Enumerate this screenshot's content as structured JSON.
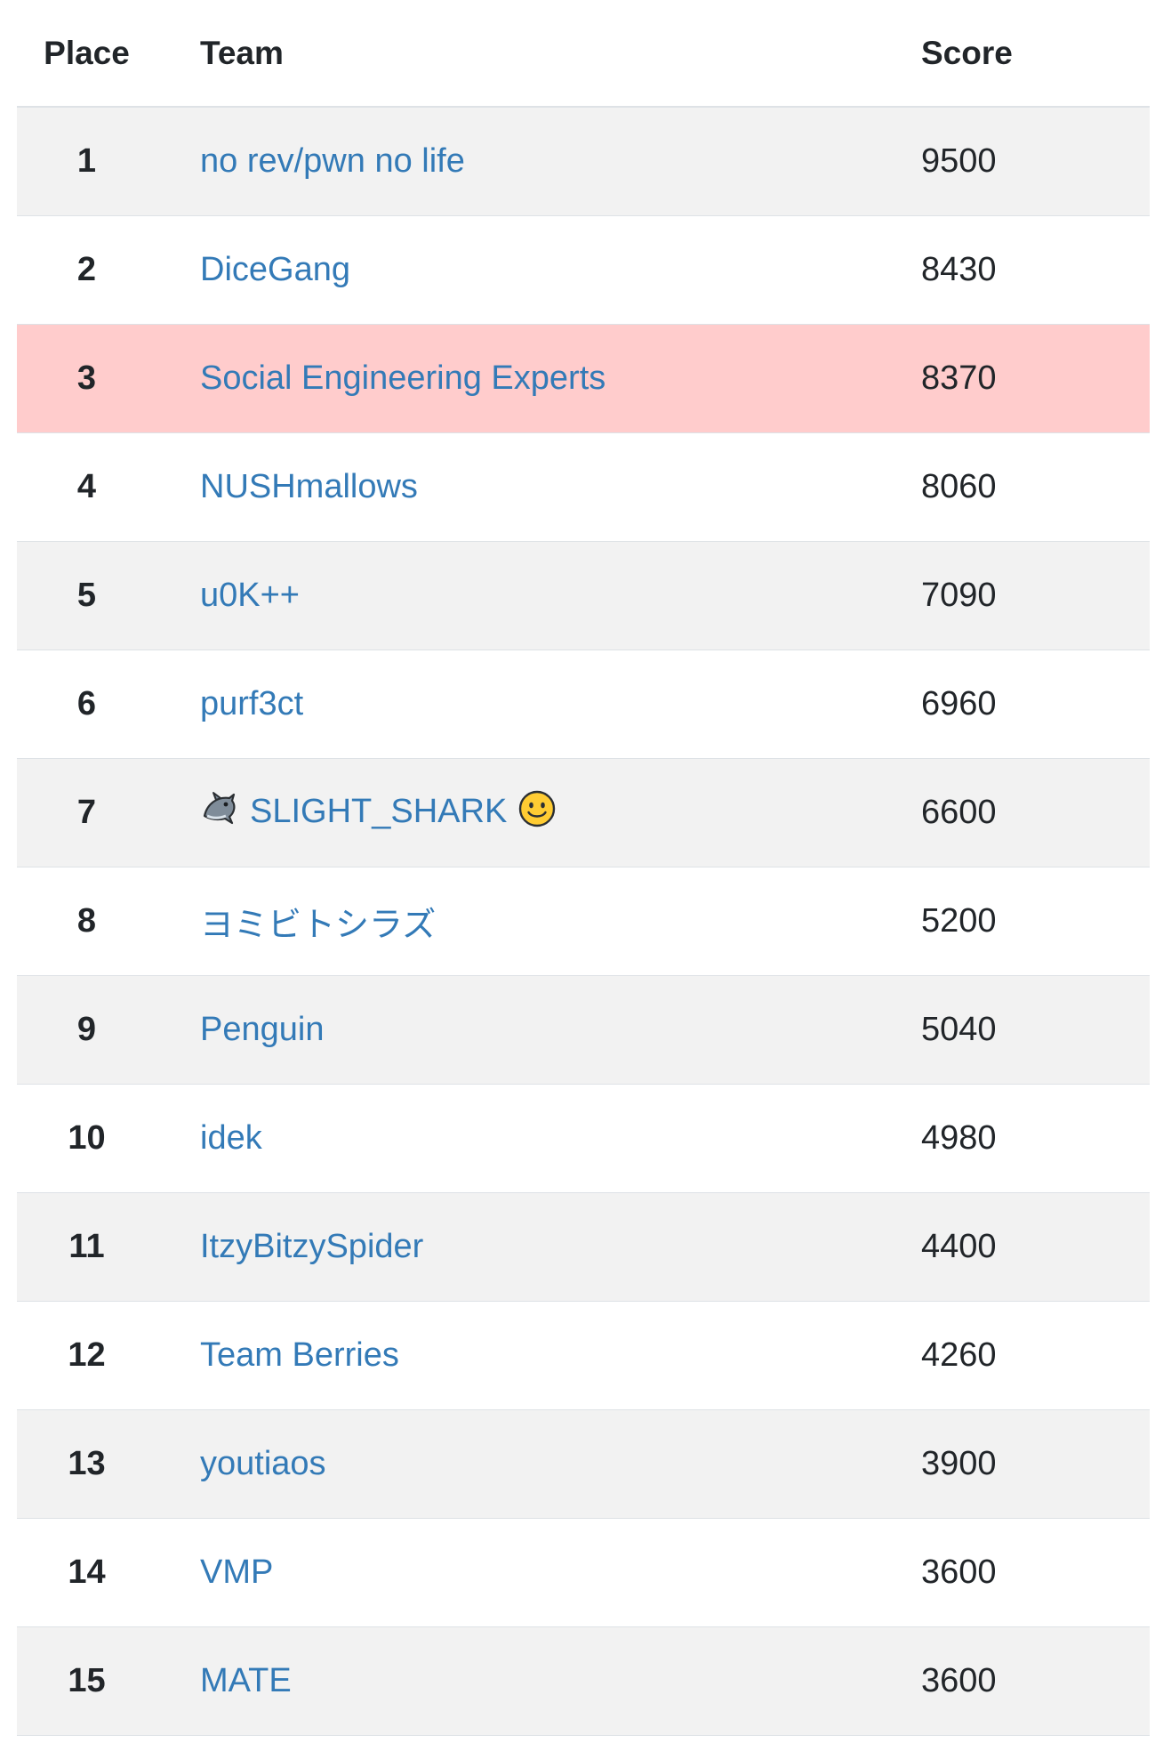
{
  "table": {
    "headers": {
      "place": "Place",
      "team": "Team",
      "score": "Score"
    },
    "highlight_color": "#ffcccc",
    "link_color": "#337ab7",
    "rows": [
      {
        "place": "1",
        "team": "no rev/pwn no life",
        "score": "9500"
      },
      {
        "place": "2",
        "team": "DiceGang",
        "score": "8430"
      },
      {
        "place": "3",
        "team": "Social Engineering Experts",
        "score": "8370",
        "highlighted": true
      },
      {
        "place": "4",
        "team": "NUSHmallows",
        "score": "8060"
      },
      {
        "place": "5",
        "team": "u0K++",
        "score": "7090"
      },
      {
        "place": "6",
        "team": "purf3ct",
        "score": "6960"
      },
      {
        "place": "7",
        "team": "SLIGHT_SHARK",
        "team_prefix_icon": "dolphin-icon",
        "team_suffix_icon": "smiley-face-icon",
        "score": "6600"
      },
      {
        "place": "8",
        "team": "ヨミビトシラズ",
        "score": "5200"
      },
      {
        "place": "9",
        "team": "Penguin",
        "score": "5040"
      },
      {
        "place": "10",
        "team": "idek",
        "score": "4980"
      },
      {
        "place": "11",
        "team": "ItzyBitzySpider",
        "score": "4400"
      },
      {
        "place": "12",
        "team": "Team Berries",
        "score": "4260"
      },
      {
        "place": "13",
        "team": "youtiaos",
        "score": "3900"
      },
      {
        "place": "14",
        "team": "VMP",
        "score": "3600"
      },
      {
        "place": "15",
        "team": "MATE",
        "score": "3600"
      }
    ]
  }
}
